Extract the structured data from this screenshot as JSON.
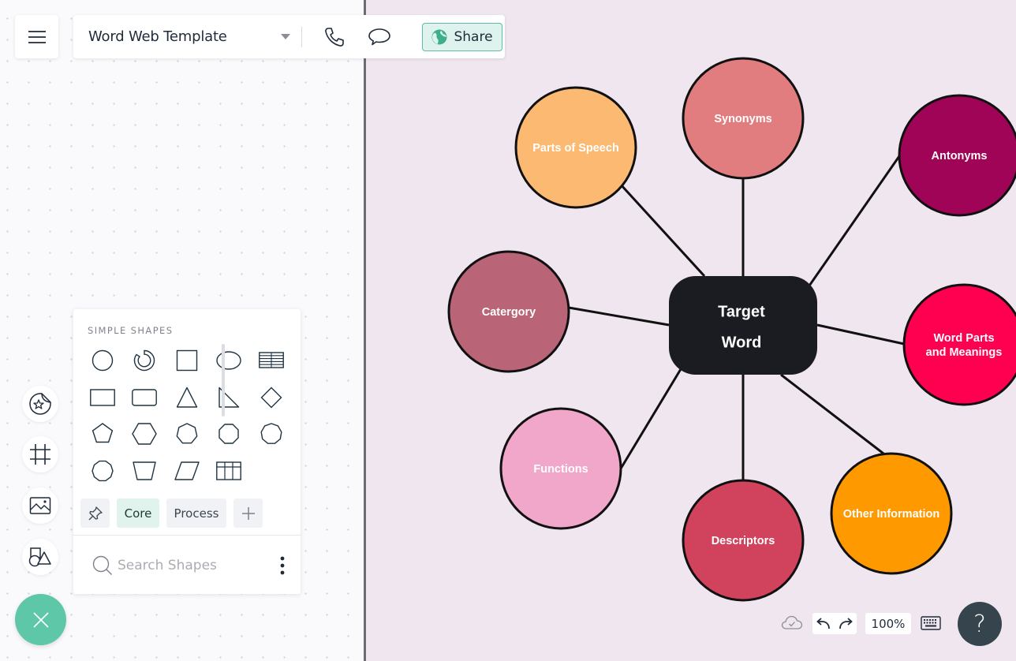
{
  "header": {
    "document_title": "Word Web Template",
    "share_label": "Share"
  },
  "shapes_panel": {
    "heading": "SIMPLE SHAPES",
    "shapes": [
      "circle",
      "arc",
      "square",
      "ellipse",
      "horizontal-table",
      "rectangle",
      "rounded-rectangle",
      "triangle",
      "right-triangle",
      "diamond",
      "pentagon",
      "hexagon",
      "heptagon",
      "octagon",
      "nonagon",
      "decagon",
      "trapezoid",
      "parallelogram",
      "grid-table"
    ],
    "library_tabs": [
      {
        "id": "pinned",
        "label": "",
        "icon": "pin-icon"
      },
      {
        "id": "core",
        "label": "Core",
        "active": true
      },
      {
        "id": "process",
        "label": "Process"
      },
      {
        "id": "add",
        "label": "",
        "icon": "plus-icon"
      }
    ],
    "search_placeholder": "Search Shapes"
  },
  "left_tools": [
    "sticker-icon",
    "frame-icon",
    "image-icon",
    "shapes-icon"
  ],
  "diagram": {
    "center": {
      "label_lines": [
        "Target",
        "Word"
      ],
      "fill": "#1a1c21"
    },
    "nodes": [
      {
        "id": "parts-of-speech",
        "label_lines": [
          "Parts of Speech"
        ],
        "fill": "#fbb972",
        "text_color": "#ffffff"
      },
      {
        "id": "synonyms",
        "label_lines": [
          "Synonyms"
        ],
        "fill": "#e17d7f",
        "text_color": "#ffffff"
      },
      {
        "id": "antonyms",
        "label_lines": [
          "Antonyms"
        ],
        "fill": "#a00457",
        "text_color": "#ffffff"
      },
      {
        "id": "categrory",
        "label_lines": [
          "Catergory"
        ],
        "fill": "#ba6577",
        "text_color": "#ffffff"
      },
      {
        "id": "word-parts",
        "label_lines": [
          "Word Parts",
          "and Meanings"
        ],
        "fill": "#ff0050",
        "text_color": "#ffffff"
      },
      {
        "id": "functions",
        "label_lines": [
          "Functions"
        ],
        "fill": "#f0a7c9",
        "text_color": "#ffffff"
      },
      {
        "id": "descriptors",
        "label_lines": [
          "Descriptors"
        ],
        "fill": "#d1425c",
        "text_color": "#ffffff"
      },
      {
        "id": "other-information",
        "label_lines": [
          "Other Information"
        ],
        "fill": "#ff9900",
        "text_color": "#fff3c8"
      }
    ]
  },
  "footer": {
    "zoom_level": "100%",
    "help_label": "?"
  },
  "colors": {
    "accent": "#5ec7a8",
    "share_bg": "#dff3ee",
    "canvas_bg": "#f0e6ef"
  }
}
